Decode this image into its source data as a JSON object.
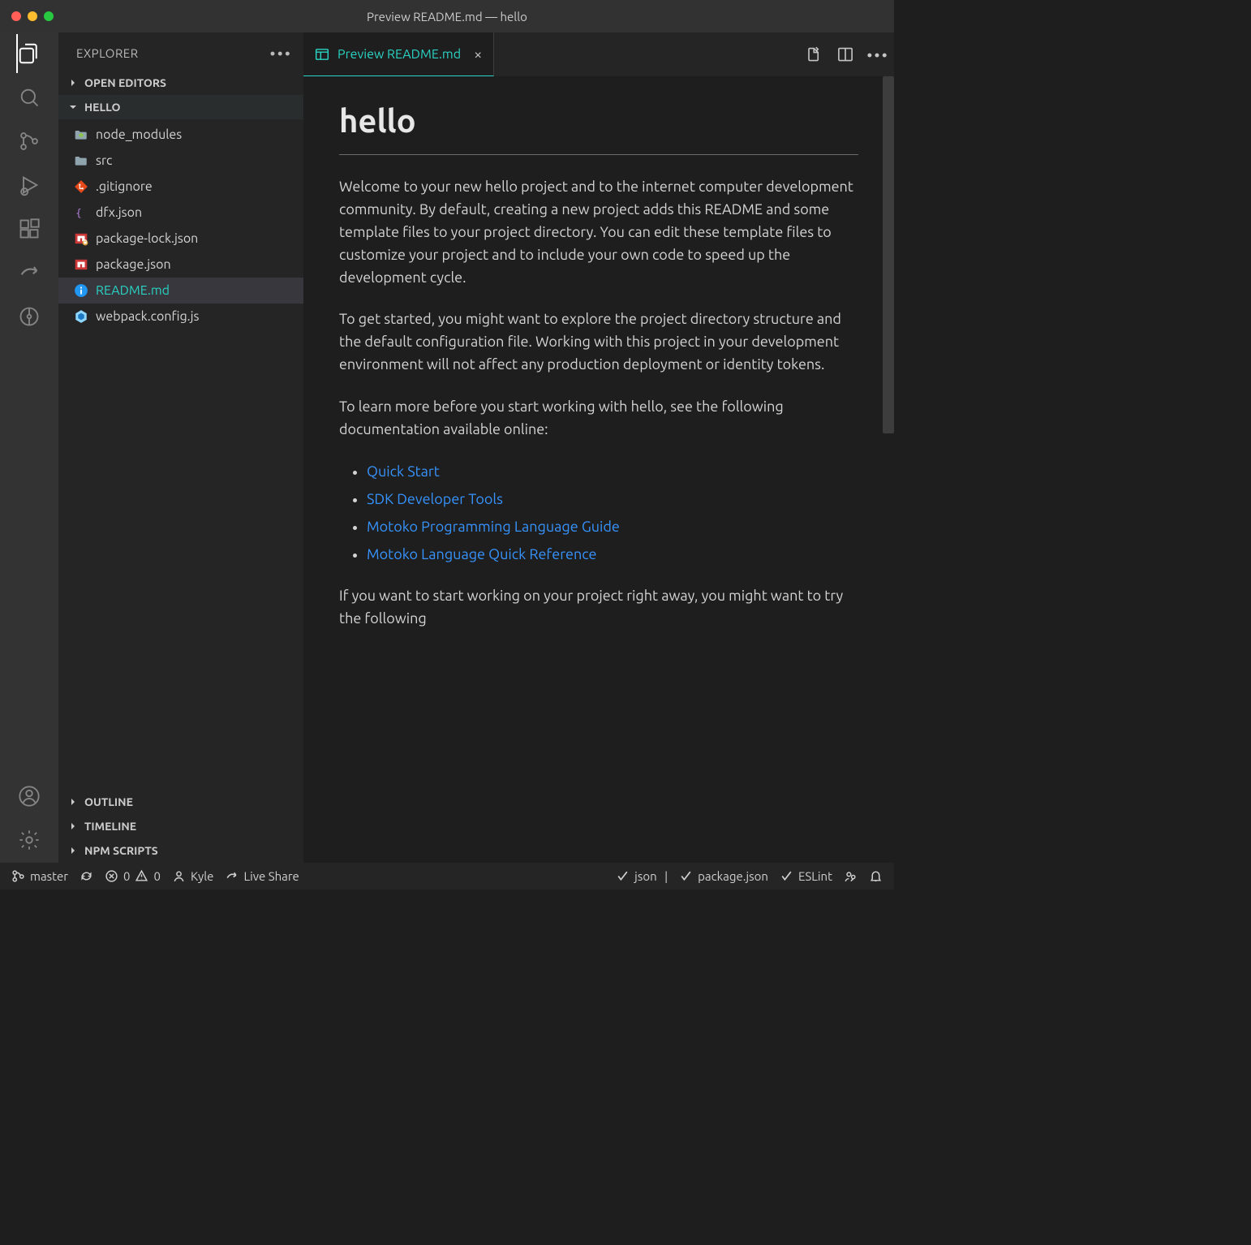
{
  "window": {
    "title": "Preview README.md — hello"
  },
  "sidebar": {
    "title": "EXPLORER",
    "sections": {
      "open_editors": "OPEN EDITORS",
      "project": "HELLO",
      "outline": "OUTLINE",
      "timeline": "TIMELINE",
      "npm": "NPM SCRIPTS"
    },
    "tree": [
      {
        "label": "node_modules",
        "kind": "folder-node"
      },
      {
        "label": "src",
        "kind": "folder"
      },
      {
        "label": ".gitignore",
        "kind": "git"
      },
      {
        "label": "dfx.json",
        "kind": "json-brace"
      },
      {
        "label": "package-lock.json",
        "kind": "npm-lock"
      },
      {
        "label": "package.json",
        "kind": "npm"
      },
      {
        "label": "README.md",
        "kind": "info",
        "selected": true
      },
      {
        "label": "webpack.config.js",
        "kind": "webpack"
      }
    ]
  },
  "tab": {
    "label": "Preview README.md"
  },
  "preview": {
    "h1": "hello",
    "p1": "Welcome to your new hello project and to the internet computer development community. By default, creating a new project adds this README and some template files to your project directory. You can edit these template files to customize your project and to include your own code to speed up the development cycle.",
    "p2": "To get started, you might want to explore the project directory structure and the default configuration file. Working with this project in your development environment will not affect any production deployment or identity tokens.",
    "p3": "To learn more before you start working with hello, see the following documentation available online:",
    "links": [
      "Quick Start",
      "SDK Developer Tools",
      "Motoko Programming Language Guide",
      "Motoko Language Quick Reference"
    ],
    "p4": "If you want to start working on your project right away, you might want to try the following"
  },
  "status": {
    "branch": "master",
    "errors": "0",
    "warnings": "0",
    "user": "Kyle",
    "liveshare": "Live Share",
    "json": "json",
    "pkg": "package.json",
    "eslint": "ESLint"
  }
}
